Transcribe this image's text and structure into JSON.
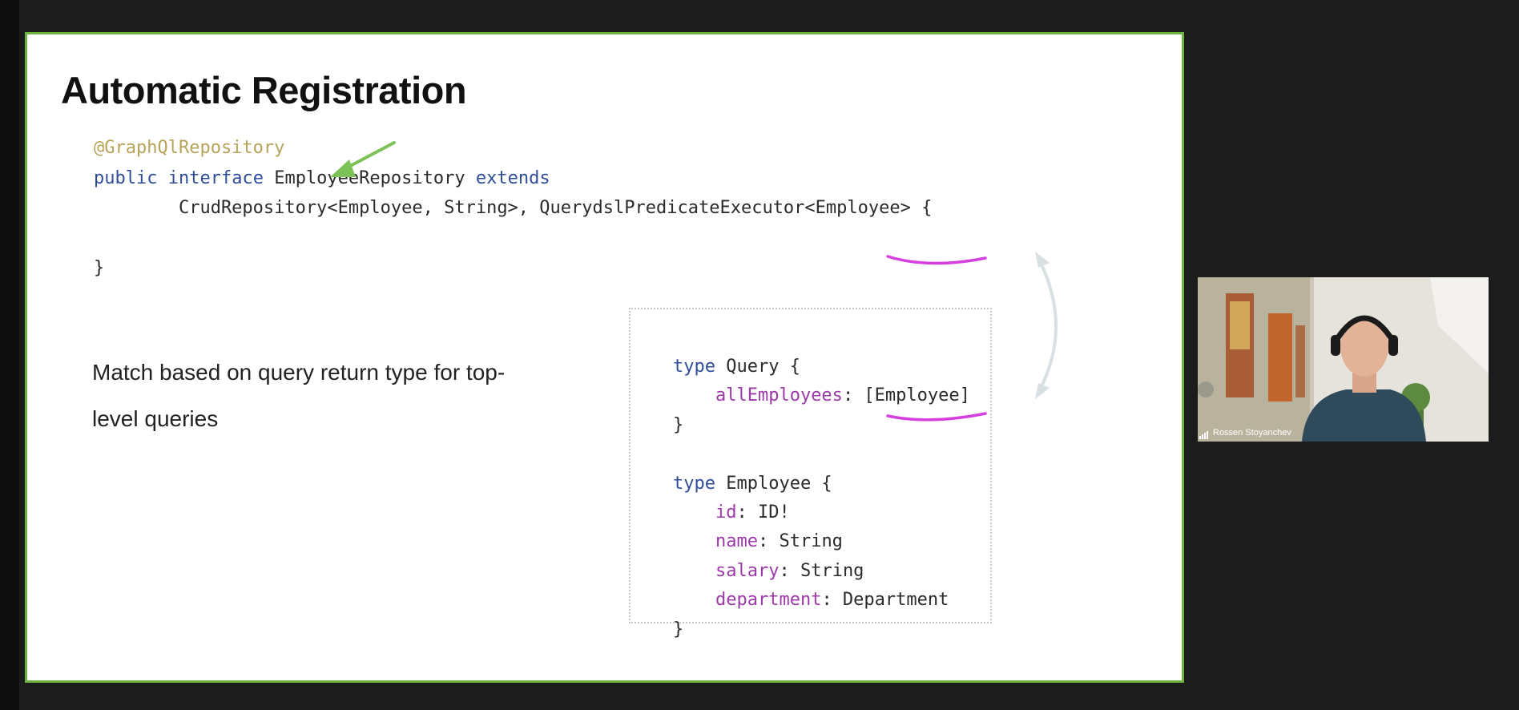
{
  "slide": {
    "title": "Automatic Registration",
    "code": {
      "annotation": "@GraphQlRepository",
      "kw_public": "public",
      "kw_interface": "interface",
      "interface_name": " EmployeeRepository ",
      "kw_extends": "extends",
      "line3": "        CrudRepository<Employee, String>, QuerydslPredicateExecutor<Employee> {",
      "closing_brace": "}"
    },
    "description": "Match based on query return type for top-level queries",
    "schema": {
      "kw_type": "type",
      "query_decl": " Query {",
      "field_allEmployees": "allEmployees",
      "field_allEmployees_type": ": [Employee]",
      "close_brace": "}",
      "employee_decl": " Employee {",
      "fields": [
        {
          "name": "id",
          "type": ": ID!"
        },
        {
          "name": "name",
          "type": ": String"
        },
        {
          "name": "salary",
          "type": ": String"
        },
        {
          "name": "department",
          "type": ": Department"
        }
      ]
    }
  },
  "video": {
    "participant_name": "Rossen Stoyanchev"
  },
  "colors": {
    "slide_border": "#6db33f",
    "keyword": "#2f4d9a",
    "annotation": "#b5a45a",
    "field": "#9b3aa8",
    "underline": "#d63ee0",
    "arrow": "#7dc256"
  }
}
